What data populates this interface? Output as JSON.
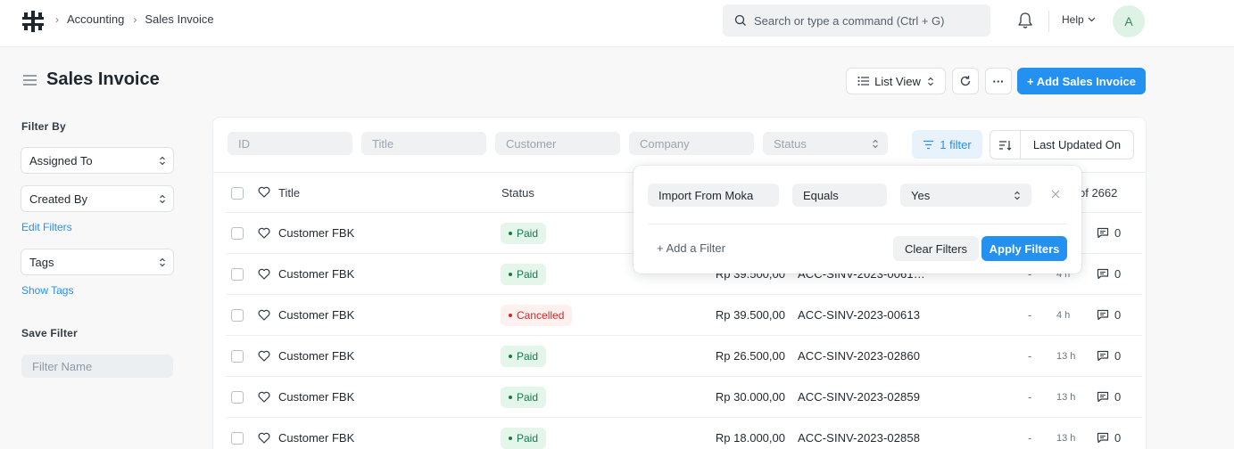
{
  "navbar": {
    "breadcrumbs": [
      "Accounting",
      "Sales Invoice"
    ],
    "search_placeholder": "Search or type a command (Ctrl + G)",
    "help_label": "Help",
    "avatar_initial": "A"
  },
  "page": {
    "title": "Sales Invoice",
    "view_label": "List View",
    "menu_label": "···",
    "add_button": "+ Add Sales Invoice"
  },
  "sidebar": {
    "filter_by_heading": "Filter By",
    "assigned_to": "Assigned To",
    "created_by": "Created By",
    "edit_filters": "Edit Filters",
    "tags": "Tags",
    "show_tags": "Show Tags",
    "save_filter_heading": "Save Filter",
    "filter_name_placeholder": "Filter Name"
  },
  "list": {
    "filters": {
      "id": "ID",
      "title": "Title",
      "customer": "Customer",
      "company": "Company",
      "status": "Status"
    },
    "filter_button": "1 filter",
    "sort_label": "Last Updated On",
    "headers": {
      "title": "Title",
      "status": "Status"
    },
    "count_text": "of 2662",
    "rows": [
      {
        "title": "Customer FBK",
        "status": "Paid",
        "amount": "",
        "invoice": "",
        "dash": "",
        "ago": "",
        "comments": "0"
      },
      {
        "title": "Customer FBK",
        "status": "Paid",
        "amount": "Rp 39.500,00",
        "invoice": "ACC-SINV-2023-0061…",
        "dash": "-",
        "ago": "4 h",
        "comments": "0"
      },
      {
        "title": "Customer FBK",
        "status": "Cancelled",
        "amount": "Rp 39.500,00",
        "invoice": "ACC-SINV-2023-00613",
        "dash": "-",
        "ago": "4 h",
        "comments": "0"
      },
      {
        "title": "Customer FBK",
        "status": "Paid",
        "amount": "Rp 26.500,00",
        "invoice": "ACC-SINV-2023-02860",
        "dash": "-",
        "ago": "13 h",
        "comments": "0"
      },
      {
        "title": "Customer FBK",
        "status": "Paid",
        "amount": "Rp 30.000,00",
        "invoice": "ACC-SINV-2023-02859",
        "dash": "-",
        "ago": "13 h",
        "comments": "0"
      },
      {
        "title": "Customer FBK",
        "status": "Paid",
        "amount": "Rp 18.000,00",
        "invoice": "ACC-SINV-2023-02858",
        "dash": "-",
        "ago": "13 h",
        "comments": "0"
      }
    ]
  },
  "filter_popover": {
    "field": "Import From Moka",
    "condition": "Equals",
    "value": "Yes",
    "add_filter": "+ Add a Filter",
    "clear": "Clear Filters",
    "apply": "Apply Filters"
  },
  "colors": {
    "primary": "#2490ef",
    "paid_bg": "#e4f5e9",
    "paid_text": "#16794c",
    "cancelled_bg": "#fff0f0",
    "cancelled_text": "#cc2929"
  }
}
